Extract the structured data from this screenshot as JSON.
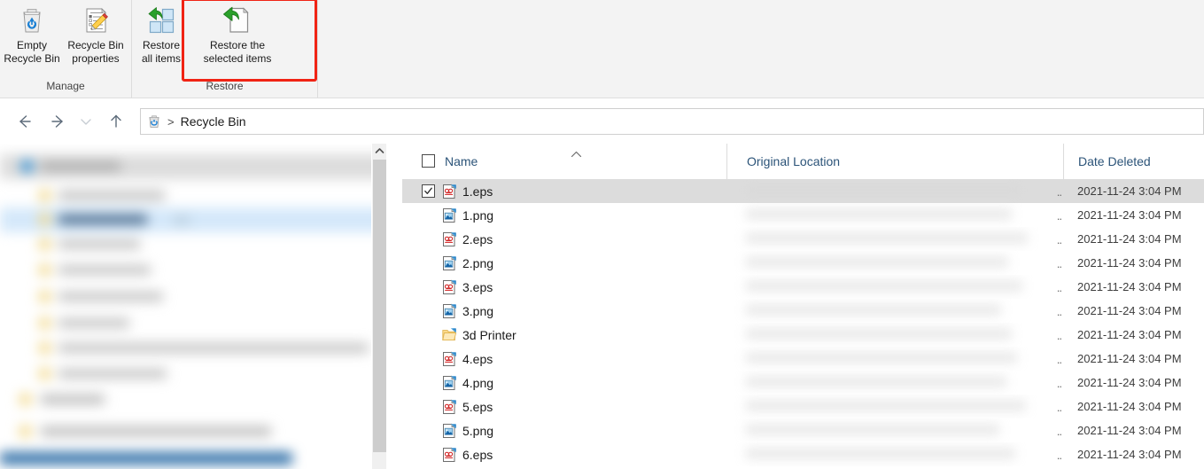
{
  "window": {
    "title": "Recycle Bin"
  },
  "ribbon": {
    "groups": [
      {
        "title": "Manage",
        "buttons": [
          {
            "label": "Empty\nRecycle Bin",
            "icon": "recycle-bin-empty-icon"
          },
          {
            "label": "Recycle Bin\nproperties",
            "icon": "properties-icon"
          }
        ]
      },
      {
        "title": "Restore",
        "buttons": [
          {
            "label": "Restore\nall items",
            "icon": "restore-all-icon"
          },
          {
            "label": "Restore the\nselected items",
            "icon": "restore-selected-icon"
          }
        ]
      }
    ]
  },
  "annotation": {
    "color": "#f02314"
  },
  "addressbar": {
    "back_label": "Back",
    "forward_label": "Forward",
    "recent_label": "Recent locations",
    "up_label": "Up",
    "crumb_icon": "recycle-bin-icon",
    "crumb_separator": ">",
    "path": "Recycle Bin"
  },
  "filelist": {
    "columns": [
      {
        "key": "name",
        "label": "Name",
        "sorted": true,
        "sort_direction": "asc"
      },
      {
        "key": "location",
        "label": "Original Location",
        "sorted": false
      },
      {
        "key": "date",
        "label": "Date Deleted",
        "sorted": false
      }
    ],
    "location_truncation": "..",
    "select_all_checked": false,
    "rows": [
      {
        "name": "1.eps",
        "icon": "eps-file-icon",
        "location": "",
        "date": "2021-11-24 3:04 PM",
        "selected": true,
        "checked": true
      },
      {
        "name": "1.png",
        "icon": "png-file-icon",
        "location": "",
        "date": "2021-11-24 3:04 PM",
        "selected": false,
        "checked": false
      },
      {
        "name": "2.eps",
        "icon": "eps-file-icon",
        "location": "",
        "date": "2021-11-24 3:04 PM",
        "selected": false,
        "checked": false
      },
      {
        "name": "2.png",
        "icon": "png-file-icon",
        "location": "",
        "date": "2021-11-24 3:04 PM",
        "selected": false,
        "checked": false
      },
      {
        "name": "3.eps",
        "icon": "eps-file-icon",
        "location": "",
        "date": "2021-11-24 3:04 PM",
        "selected": false,
        "checked": false
      },
      {
        "name": "3.png",
        "icon": "png-file-icon",
        "location": "",
        "date": "2021-11-24 3:04 PM",
        "selected": false,
        "checked": false
      },
      {
        "name": "3d Printer",
        "icon": "folder-icon",
        "location": "",
        "date": "2021-11-24 3:04 PM",
        "selected": false,
        "checked": false
      },
      {
        "name": "4.eps",
        "icon": "eps-file-icon",
        "location": "",
        "date": "2021-11-24 3:04 PM",
        "selected": false,
        "checked": false
      },
      {
        "name": "4.png",
        "icon": "png-file-icon",
        "location": "",
        "date": "2021-11-24 3:04 PM",
        "selected": false,
        "checked": false
      },
      {
        "name": "5.eps",
        "icon": "eps-file-icon",
        "location": "",
        "date": "2021-11-24 3:04 PM",
        "selected": false,
        "checked": false
      },
      {
        "name": "5.png",
        "icon": "png-file-icon",
        "location": "",
        "date": "2021-11-24 3:04 PM",
        "selected": false,
        "checked": false
      },
      {
        "name": "6.eps",
        "icon": "eps-file-icon",
        "location": "",
        "date": "2021-11-24 3:04 PM",
        "selected": false,
        "checked": false
      }
    ]
  },
  "navpane": {
    "blurred": true,
    "scrollbar": {
      "up_arrow": "chevron-up-icon"
    }
  }
}
